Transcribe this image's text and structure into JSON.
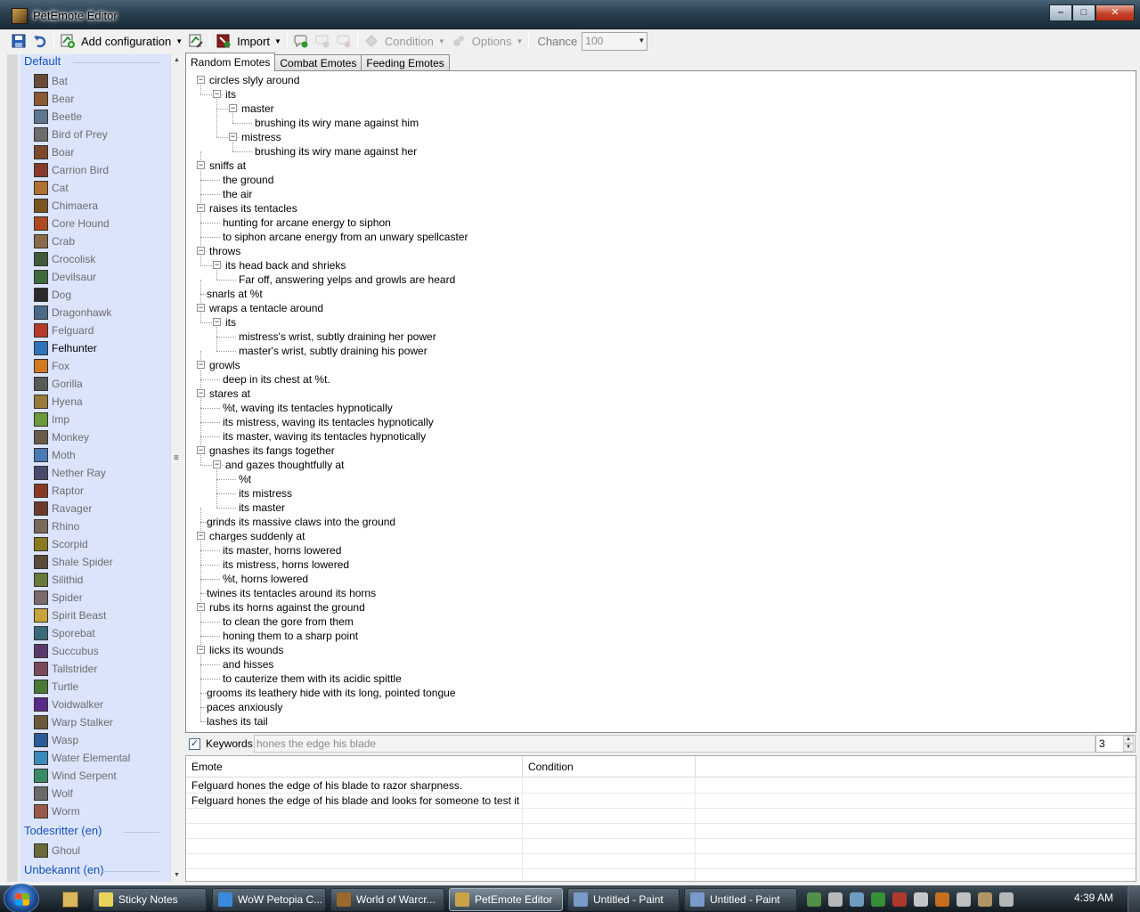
{
  "window": {
    "title": "PetEmote Editor",
    "controls": {
      "minimize": "–",
      "maximize": "□",
      "close": "✕"
    }
  },
  "toolbar": {
    "add_configuration": "Add configuration",
    "import": "Import",
    "condition": "Condition",
    "options": "Options",
    "chance_label": "Chance",
    "chance_value": "100"
  },
  "sidebar": {
    "groups": [
      {
        "label": "Default",
        "items": [
          "Bat",
          "Bear",
          "Beetle",
          "Bird of Prey",
          "Boar",
          "Carrion Bird",
          "Cat",
          "Chimaera",
          "Core Hound",
          "Crab",
          "Crocolisk",
          "Devilsaur",
          "Dog",
          "Dragonhawk",
          "Felguard",
          "Felhunter",
          "Fox",
          "Gorilla",
          "Hyena",
          "Imp",
          "Monkey",
          "Moth",
          "Nether Ray",
          "Raptor",
          "Ravager",
          "Rhino",
          "Scorpid",
          "Shale Spider",
          "Silithid",
          "Spider",
          "Spirit Beast",
          "Sporebat",
          "Succubus",
          "Tallstrider",
          "Turtle",
          "Voidwalker",
          "Warp Stalker",
          "Wasp",
          "Water Elemental",
          "Wind Serpent",
          "Wolf",
          "Worm"
        ]
      },
      {
        "label": "Todesritter (en)",
        "items": [
          "Ghoul"
        ]
      },
      {
        "label": "Unbekannt (en)",
        "items": []
      }
    ],
    "selected": "Felhunter",
    "icon_colors": [
      "#6a4b3a",
      "#8a5a33",
      "#5d7790",
      "#6e6e6e",
      "#7a4a2a",
      "#8a3a2a",
      "#b07030",
      "#7a5522",
      "#b04a1e",
      "#8a6a4a",
      "#3f5a3a",
      "#3d6a3d",
      "#2a2a2a",
      "#4a6a8a",
      "#b83a2a",
      "#2f73b8",
      "#d07a22",
      "#5a5a5a",
      "#9a7a3a",
      "#6a9a3a",
      "#6a5a4a",
      "#4a7ab8",
      "#4a4a6a",
      "#8a3a22",
      "#6a3a2a",
      "#7a6a5a",
      "#8a7a22",
      "#5a4a3a",
      "#6a7a3a",
      "#7a6a6a",
      "#c8a23a",
      "#3a6a7a",
      "#5a3a6a",
      "#7a4a5a",
      "#4a7a3a",
      "#5a2a8a",
      "#6a5a3a",
      "#2a5a9a",
      "#3a8aba",
      "#3a8a6a",
      "#6a6a6a",
      "#9a5a4a",
      "#6a6a3a"
    ]
  },
  "tabs": [
    "Random Emotes",
    "Combat Emotes",
    "Feeding Emotes"
  ],
  "tree": [
    {
      "d": 0,
      "t": "circles slyly around",
      "pm": "-"
    },
    {
      "d": 1,
      "t": "its",
      "pm": "-"
    },
    {
      "d": 2,
      "t": "master",
      "pm": "-"
    },
    {
      "d": 3,
      "t": "brushing its wiry mane against him"
    },
    {
      "d": 2,
      "t": "mistress",
      "pm": "-"
    },
    {
      "d": 3,
      "t": "brushing its wiry mane against her"
    },
    {
      "d": 0,
      "t": "sniffs at",
      "pm": "-"
    },
    {
      "d": 1,
      "t": "the ground"
    },
    {
      "d": 1,
      "t": "the air"
    },
    {
      "d": 0,
      "t": "raises its tentacles",
      "pm": "-"
    },
    {
      "d": 1,
      "t": "hunting for arcane energy to siphon"
    },
    {
      "d": 1,
      "t": "to siphon arcane energy from an unwary spellcaster"
    },
    {
      "d": 0,
      "t": "throws",
      "pm": "-"
    },
    {
      "d": 1,
      "t": "its head back and shrieks",
      "pm": "-"
    },
    {
      "d": 2,
      "t": "Far off, answering yelps and growls are heard"
    },
    {
      "d": 0,
      "t": "snarls at %t"
    },
    {
      "d": 0,
      "t": "wraps a tentacle around",
      "pm": "-"
    },
    {
      "d": 1,
      "t": "its",
      "pm": "-"
    },
    {
      "d": 2,
      "t": "mistress's wrist, subtly draining her power"
    },
    {
      "d": 2,
      "t": "master's wrist, subtly draining his power"
    },
    {
      "d": 0,
      "t": "growls",
      "pm": "-"
    },
    {
      "d": 1,
      "t": "deep in its chest at %t."
    },
    {
      "d": 0,
      "t": "stares at",
      "pm": "-"
    },
    {
      "d": 1,
      "t": "%t, waving its tentacles hypnotically"
    },
    {
      "d": 1,
      "t": "its mistress, waving its tentacles hypnotically"
    },
    {
      "d": 1,
      "t": "its master, waving its tentacles hypnotically"
    },
    {
      "d": 0,
      "t": "gnashes its fangs together",
      "pm": "-"
    },
    {
      "d": 1,
      "t": "and gazes thoughtfully at",
      "pm": "-"
    },
    {
      "d": 2,
      "t": "%t"
    },
    {
      "d": 2,
      "t": "its mistress"
    },
    {
      "d": 2,
      "t": "its master"
    },
    {
      "d": 0,
      "t": "grinds its massive claws into the ground"
    },
    {
      "d": 0,
      "t": "charges suddenly at",
      "pm": "-"
    },
    {
      "d": 1,
      "t": "its master, horns lowered"
    },
    {
      "d": 1,
      "t": "its mistress, horns lowered"
    },
    {
      "d": 1,
      "t": "%t, horns lowered"
    },
    {
      "d": 0,
      "t": "twines its tentacles around its horns"
    },
    {
      "d": 0,
      "t": "rubs its horns against the ground",
      "pm": "-"
    },
    {
      "d": 1,
      "t": "to clean the gore from them"
    },
    {
      "d": 1,
      "t": "honing them to a sharp point"
    },
    {
      "d": 0,
      "t": "licks its wounds",
      "pm": "-"
    },
    {
      "d": 1,
      "t": "and hisses"
    },
    {
      "d": 1,
      "t": "to cauterize them with its acidic spittle"
    },
    {
      "d": 0,
      "t": "grooms its leathery hide with its long, pointed tongue"
    },
    {
      "d": 0,
      "t": "paces anxiously"
    },
    {
      "d": 0,
      "t": "lashes its tail"
    }
  ],
  "keywords": {
    "label": "Keywords",
    "checked": "✓",
    "value": "hones the edge his blade",
    "spin_value": "3"
  },
  "grid": {
    "columns": [
      "Emote",
      "Condition"
    ],
    "rows": [
      [
        "Felguard hones the edge of his blade to razor sharpness.",
        ""
      ],
      [
        "Felguard hones the edge of his blade and looks for someone to test it on.",
        ""
      ]
    ]
  },
  "taskbar": {
    "tasks": [
      {
        "label": "Sticky Notes",
        "color": "#e8d25a"
      },
      {
        "label": "WoW Petopia C...",
        "color": "#3a8adc"
      },
      {
        "label": "World of Warcr...",
        "color": "#9a6a2a"
      },
      {
        "label": "PetEmote Editor",
        "color": "#c9a24a",
        "active": true
      },
      {
        "label": "Untitled - Paint",
        "color": "#7a9acb"
      },
      {
        "label": "Untitled - Paint",
        "color": "#7a9acb"
      }
    ],
    "clock": "4:39 AM"
  }
}
